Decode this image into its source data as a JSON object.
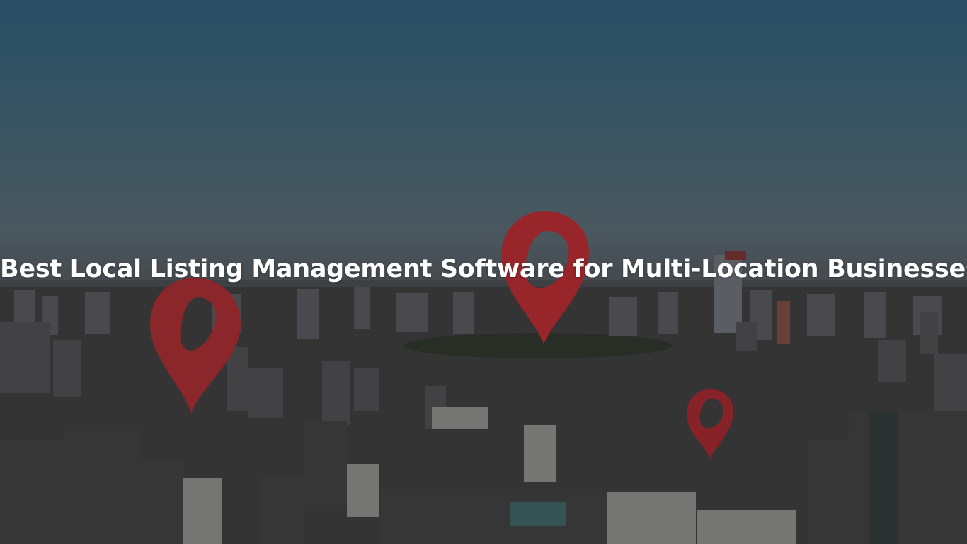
{
  "headline": "Best Local Listing Management Software for Multi-Location Businesses",
  "pin_color": "#b3272c",
  "pin_shadow_color": "#6e1418"
}
